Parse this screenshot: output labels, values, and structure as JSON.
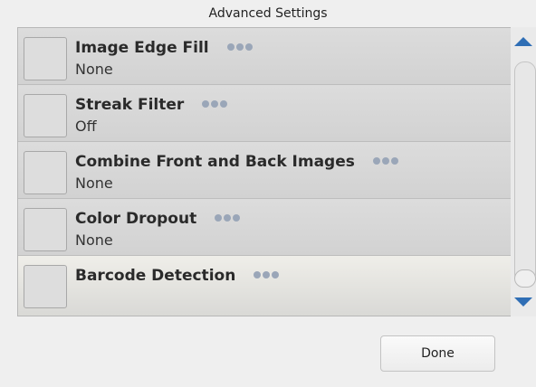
{
  "dialog": {
    "title": "Advanced Settings"
  },
  "settings": [
    {
      "label": "Image Edge Fill",
      "value": "None"
    },
    {
      "label": "Streak Filter",
      "value": "Off"
    },
    {
      "label": "Combine Front and Back Images",
      "value": "None"
    },
    {
      "label": "Color Dropout",
      "value": "None"
    },
    {
      "label": "Barcode Detection",
      "value": ""
    }
  ],
  "buttons": {
    "done": "Done"
  },
  "colors": {
    "accent": "#2f6eb5",
    "dots": "#9aa6b8"
  }
}
